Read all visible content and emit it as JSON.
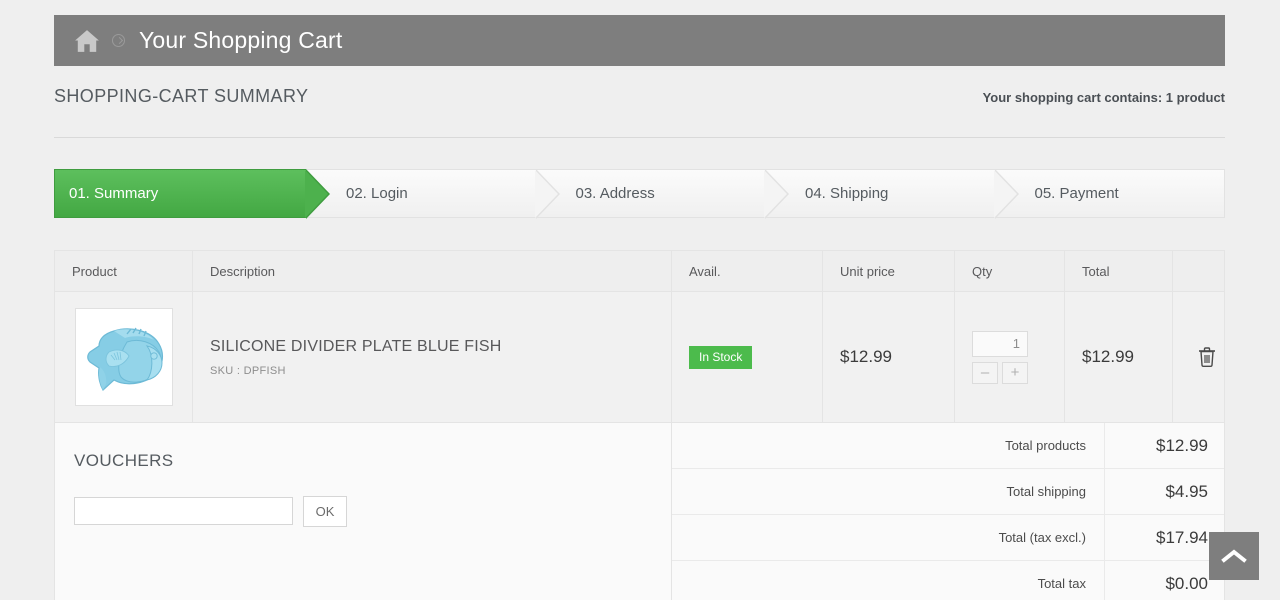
{
  "header": {
    "home_icon": "home-icon",
    "separator_icon": "chevron-circle-icon",
    "title": "Your Shopping Cart",
    "bar_color": "#7e7e7e"
  },
  "summary": {
    "title": "SHOPPING-CART SUMMARY",
    "cart_contains": "Your shopping cart contains: 1 product"
  },
  "steps": [
    {
      "label": "01. Summary",
      "state": "current"
    },
    {
      "label": "02. Login",
      "state": "upcoming"
    },
    {
      "label": "03. Address",
      "state": "upcoming"
    },
    {
      "label": "04. Shipping",
      "state": "upcoming"
    },
    {
      "label": "05. Payment",
      "state": "upcoming"
    }
  ],
  "step_active_color": "#4cbb4c",
  "cart_table": {
    "headers": {
      "product": "Product",
      "description": "Description",
      "avail": "Avail.",
      "unit_price": "Unit price",
      "qty": "Qty",
      "total": "Total",
      "action": ""
    },
    "rows": [
      {
        "image_icon": "blue-fish-plate-image",
        "name": "SILICONE DIVIDER PLATE BLUE FISH",
        "sku": "SKU : DPFISH",
        "availability": "In Stock",
        "availability_color": "#4cbb4c",
        "unit_price": "$12.99",
        "qty_value": "1",
        "qty_decrease": "–",
        "qty_increase": "+",
        "total": "$12.99",
        "delete_icon": "trash-icon"
      }
    ]
  },
  "vouchers": {
    "title": "VOUCHERS",
    "input_value": "",
    "input_placeholder": "",
    "ok_label": "OK"
  },
  "totals": [
    {
      "label": "Total products",
      "value": "$12.99"
    },
    {
      "label": "Total shipping",
      "value": "$4.95"
    },
    {
      "label": "Total (tax excl.)",
      "value": "$17.94"
    },
    {
      "label": "Total tax",
      "value": "$0.00"
    }
  ],
  "scroll_top": {
    "icon": "chevron-up-icon"
  }
}
